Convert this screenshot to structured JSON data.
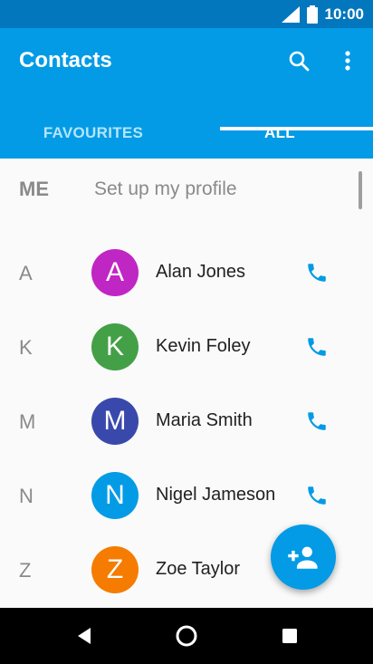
{
  "status_bar": {
    "time": "10:00"
  },
  "app_bar": {
    "title": "Contacts",
    "search_icon": "search-icon",
    "more_icon": "more-vert-icon"
  },
  "tabs": [
    {
      "label": "FAVOURITES",
      "selected": false
    },
    {
      "label": "ALL",
      "selected": true
    }
  ],
  "me": {
    "letter": "ME",
    "label": "Set up my profile"
  },
  "contacts": [
    {
      "section": "A",
      "initial": "A",
      "name": "Alan Jones",
      "color": "#c026c4"
    },
    {
      "section": "K",
      "initial": "K",
      "name": "Kevin Foley",
      "color": "#43a047"
    },
    {
      "section": "M",
      "initial": "M",
      "name": "Maria Smith",
      "color": "#3949ab"
    },
    {
      "section": "N",
      "initial": "N",
      "name": "Nigel Jameson",
      "color": "#039be5"
    },
    {
      "section": "Z",
      "initial": "Z",
      "name": "Zoe Taylor",
      "color": "#f57c00"
    }
  ],
  "colors": {
    "status_bar": "#0277bd",
    "app_bar": "#039be5",
    "accent": "#039be5"
  },
  "fab_icon": "add-person-icon"
}
